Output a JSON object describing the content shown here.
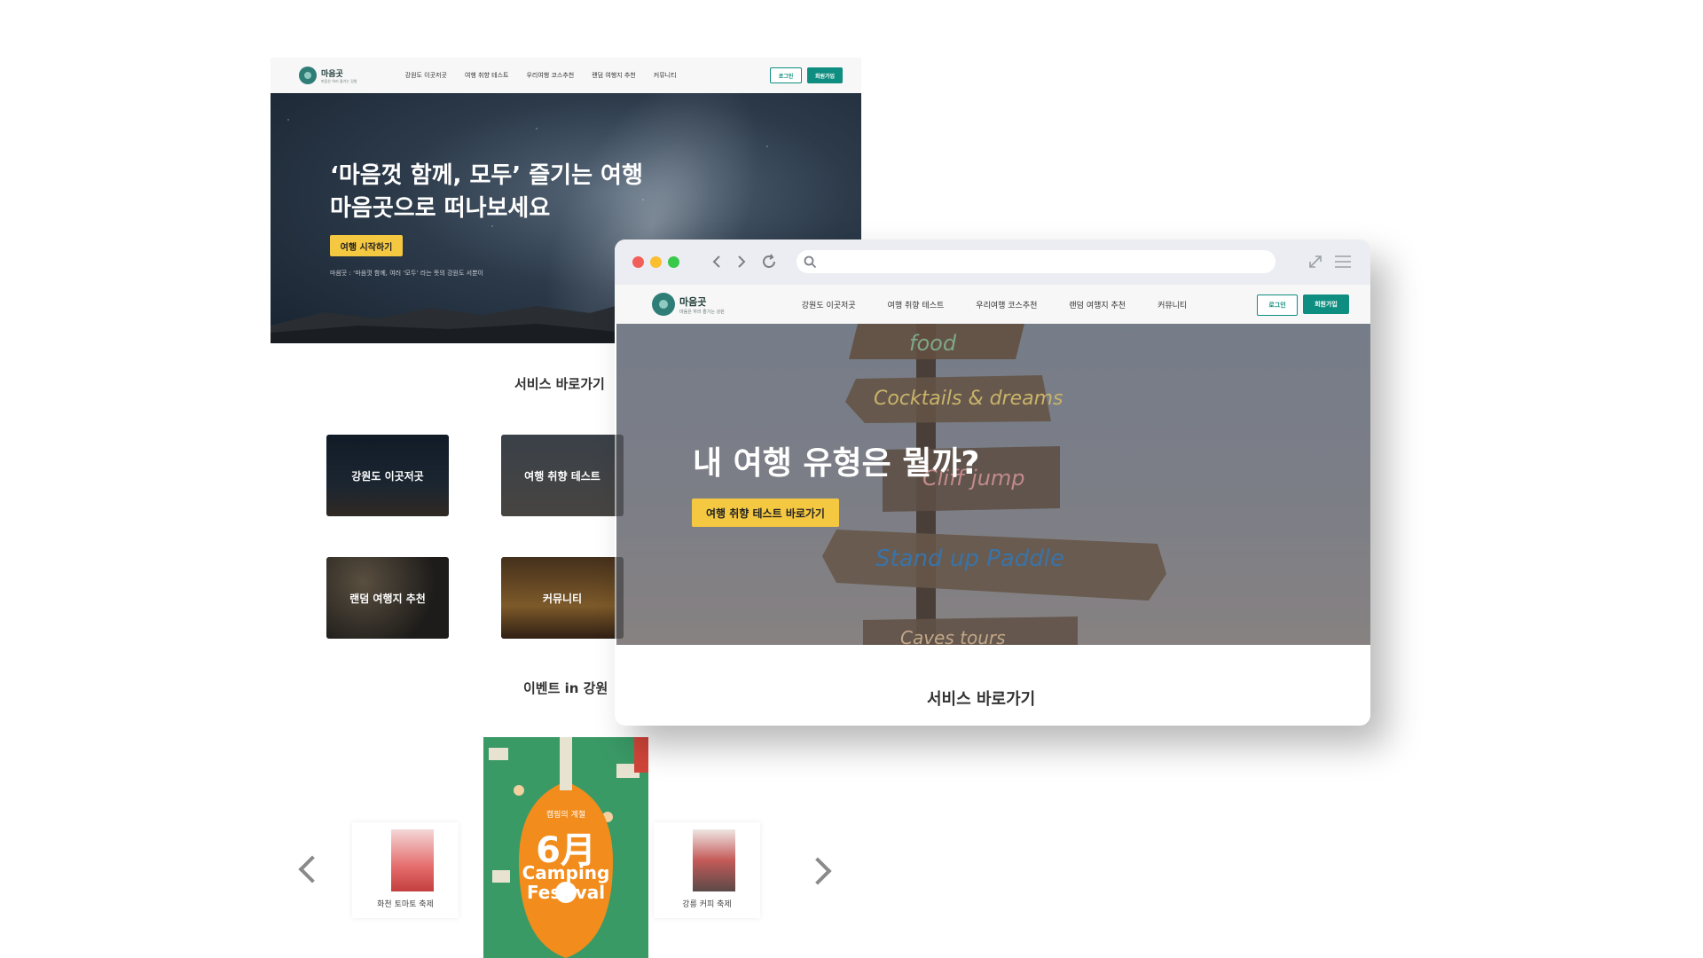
{
  "site": {
    "logo_title": "마음곳",
    "logo_subtitle": "마음은 하러 즐기는 강원",
    "nav_items": [
      "강원도 이곳저곳",
      "여행 취향 테스트",
      "우리여행 코스추천",
      "랜덤 여행지 추천",
      "커뮤니티"
    ],
    "login_label": "로그인",
    "signup_label": "회원가입"
  },
  "back_page": {
    "hero_title_line1": "‘마음껏 함께, 모두’ 즐기는 여행",
    "hero_title_line2": "마음곳으로 떠나보세요",
    "hero_button": "여행 시작하기",
    "hero_caption": "마음곳 : ‘마음껏 함께, 여러 ‘모두’ 라는 뜻의 강원도 서뿐이",
    "services_title": "서비스 바로가기",
    "cards": [
      {
        "label": "강원도 이곳저곳"
      },
      {
        "label": "여행 취향 테스트"
      },
      {
        "label": "랜덤 여행지 추천"
      },
      {
        "label": "커뮤니티"
      }
    ],
    "events_title": "이벤트 in 강원",
    "poster_left_name": "화천 토마토 축제",
    "poster_right_name": "강릉 커피 축제",
    "poster_main": {
      "top_text": "캠핑의 계절",
      "month": "6月",
      "line1": "Camping",
      "line2": "Festival"
    }
  },
  "browser": {
    "hero_title": "내 여행 유형은 뭘까?",
    "hero_button": "여행 취향 테스트 바로가기",
    "services_title": "서비스 바로가기",
    "signpost_words": [
      "food",
      "Cocktails & dreams",
      "Cliff jump",
      "Stand up Paddle",
      "Caves tours"
    ]
  },
  "colors": {
    "brand_teal": "#0e8e80",
    "accent_yellow": "#f5c842",
    "traffic_red": "#f25f58",
    "traffic_yellow": "#fbbe2e",
    "traffic_green": "#38c94a"
  },
  "icons": [
    "back-icon",
    "forward-icon",
    "reload-icon",
    "search-icon",
    "expand-icon",
    "menu-icon",
    "prev-arrow-icon",
    "next-arrow-icon"
  ]
}
